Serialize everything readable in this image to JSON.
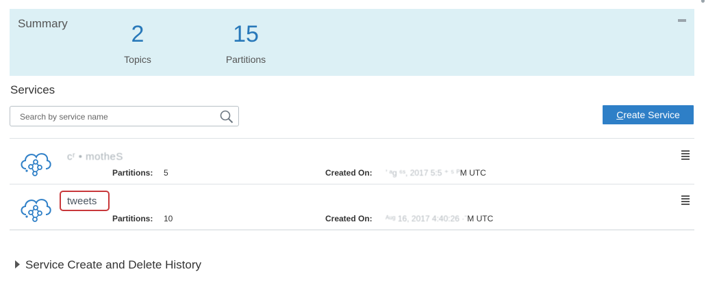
{
  "summary": {
    "title": "Summary",
    "topics": {
      "value": "2",
      "label": "Topics"
    },
    "partitions": {
      "value": "15",
      "label": "Partitions"
    }
  },
  "services": {
    "title": "Services",
    "search_placeholder": "Search by service name",
    "create_button_label_first": "C",
    "create_button_label_rest": "reate Service",
    "rows": [
      {
        "name": "cʳ • motheS",
        "partitions_label": "Partitions:",
        "partitions_value": "5",
        "created_label": "Created On:",
        "created_value_faded": "’ ᵃg ⁶ˢ, 2017 5:5 ⁺ ⁵ ᴾ",
        "created_value_suffix": "M UTC"
      },
      {
        "name": "tweets",
        "partitions_label": "Partitions:",
        "partitions_value": "10",
        "created_label": "Created On:",
        "created_value_faded": "ᴬᵘᵍ 16, 2017 4:40:26 ·ˉ",
        "created_value_suffix": "M UTC"
      }
    ]
  },
  "history": {
    "label": "Service Create and Delete History"
  },
  "colors": {
    "summary_bg": "#dcf0f5",
    "stat_blue": "#2878b9",
    "button_blue": "#2e7fc7",
    "highlight_red": "#c8373a"
  },
  "icons": [
    "collapse-icon",
    "search-icon",
    "cloud-service-icon",
    "row-menu-icon",
    "expand-arrow-icon"
  ]
}
